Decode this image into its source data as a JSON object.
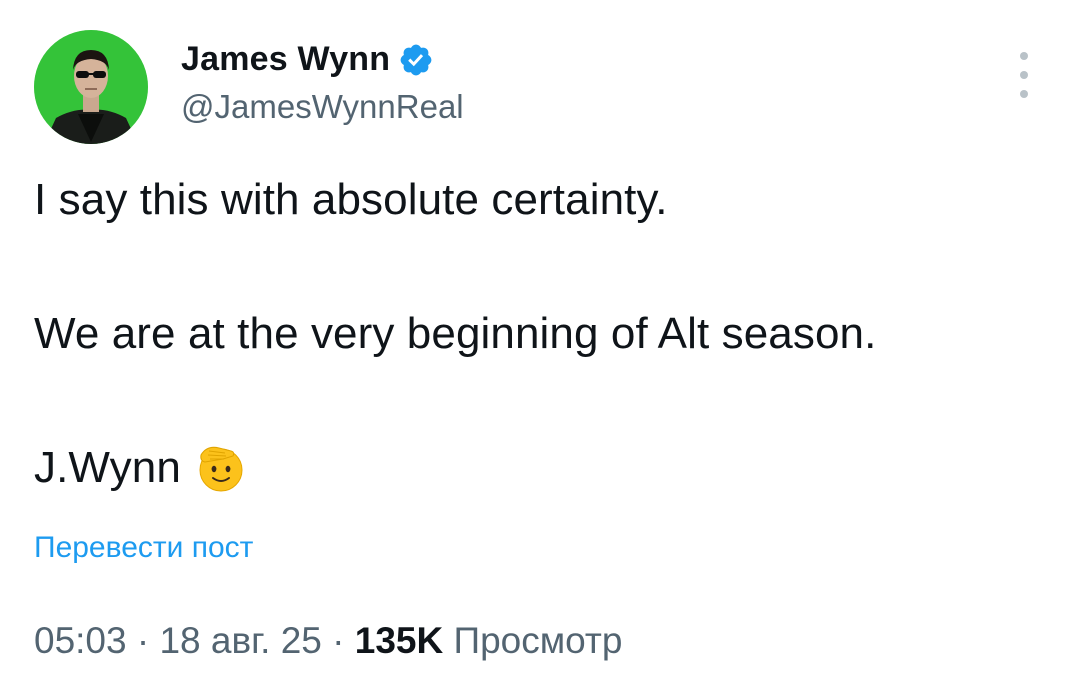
{
  "author": {
    "name": "James Wynn",
    "handle": "@JamesWynnReal",
    "verified": true
  },
  "tweet": {
    "line_1": "I say this with absolute certainty.",
    "line_2": "We are at the very beginning of Alt season.",
    "line_3": "J.Wynn",
    "emoji": "saluting-face"
  },
  "translate_label": "Перевести пост",
  "meta": {
    "time": "05:03",
    "separator": "·",
    "date": "18 авг. 25",
    "views_count": "135K",
    "views_label": "Просмотр"
  },
  "colors": {
    "text": "#0f1419",
    "secondary": "#536471",
    "link": "#1d9bf0",
    "verified": "#1d9bf0",
    "avatar_background": "#38c93c"
  },
  "icons": {
    "verified": "verified-badge-icon",
    "more": "more-options-icon",
    "emoji": "saluting-face-emoji"
  }
}
